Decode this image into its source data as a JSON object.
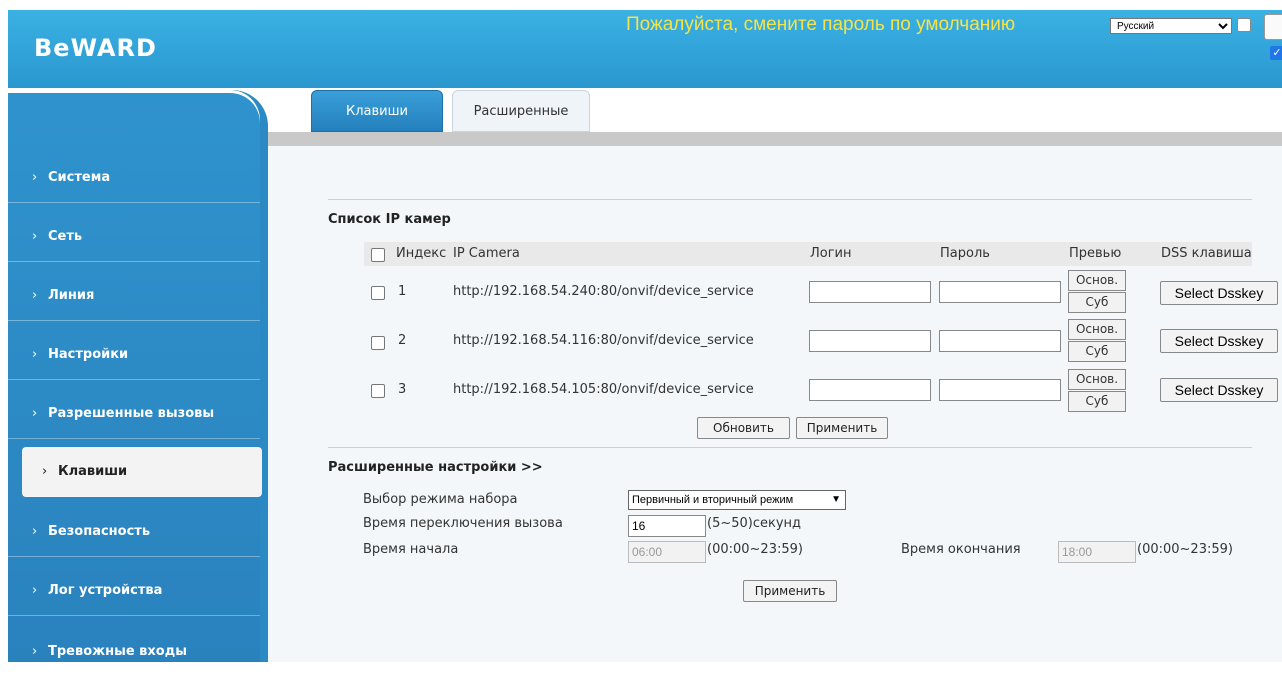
{
  "header": {
    "logo": "BeWARD",
    "warning": "Пожалуйста, смените пароль по умолчанию",
    "language": "Русский"
  },
  "sidebar": {
    "items": [
      {
        "label": "Система"
      },
      {
        "label": "Сеть"
      },
      {
        "label": "Линия"
      },
      {
        "label": "Настройки"
      },
      {
        "label": "Разрешенные вызовы"
      },
      {
        "label": "Клавиши",
        "active": true
      },
      {
        "label": "Безопасность"
      },
      {
        "label": "Лог устройства"
      },
      {
        "label": "Тревожные входы"
      }
    ]
  },
  "tabs": [
    {
      "label": "Клавиши",
      "active": true
    },
    {
      "label": "Расширенные",
      "active": false
    }
  ],
  "camera_list": {
    "title": "Список IP камер",
    "columns": {
      "index": "Индекс",
      "ip_camera": "IP Camera",
      "login": "Логин",
      "password": "Пароль",
      "preview": "Превью",
      "dss_key": "DSS клавиша"
    },
    "rows": [
      {
        "index": "1",
        "url": "http://192.168.54.240:80/onvif/device_service",
        "login": "",
        "password": ""
      },
      {
        "index": "2",
        "url": "http://192.168.54.116:80/onvif/device_service",
        "login": "",
        "password": ""
      },
      {
        "index": "3",
        "url": "http://192.168.54.105:80/onvif/device_service",
        "login": "",
        "password": ""
      }
    ],
    "preview_main": "Основ.",
    "preview_sub": "Суб",
    "dss_button": "Select Dsskey",
    "refresh_button": "Обновить",
    "apply_button": "Применить"
  },
  "advanced": {
    "title": "Расширенные настройки >>",
    "dial_mode_label": "Выбор режима набора",
    "dial_mode_value": "Первичный и вторичный режим",
    "switch_time_label": "Время переключения вызова",
    "switch_time_value": "16",
    "switch_time_hint": "(5~50)секунд",
    "start_time_label": "Время начала",
    "start_time_value": "06:00",
    "start_time_hint": "(00:00~23:59)",
    "end_time_label": "Время окончания",
    "end_time_value": "18:00",
    "end_time_hint": "(00:00~23:59)",
    "apply_button": "Применить"
  }
}
